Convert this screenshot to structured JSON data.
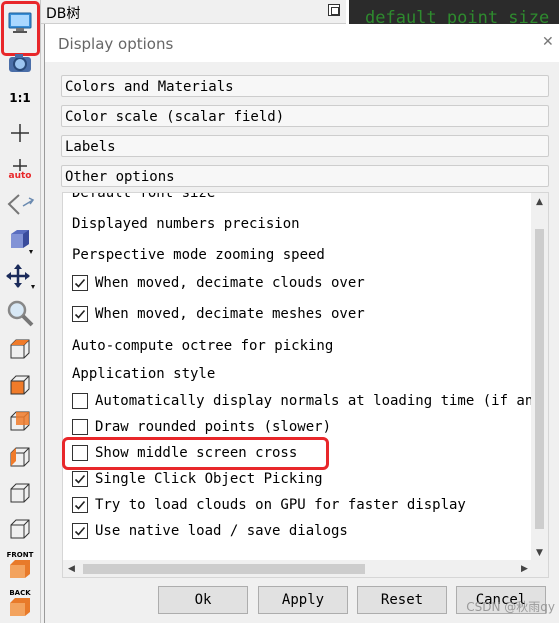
{
  "dbtree": {
    "title": "DB树"
  },
  "console": {
    "text": "default point size"
  },
  "toolbar": {
    "label_1to1": "1:1",
    "label_auto": "auto",
    "label_front": "FRONT",
    "label_back": "BACK",
    "accent": "#e8272a"
  },
  "dialog": {
    "title": "Display options",
    "sections": {
      "colors": "Colors and Materials",
      "color_scale": "Color scale (scalar field)",
      "labels": "Labels",
      "other": "Other options"
    },
    "rows": {
      "font_size": "Default font size",
      "precision": "Displayed numbers precision",
      "zoom": "Perspective mode zooming speed",
      "decimate_clouds": "When moved, decimate clouds over",
      "decimate_meshes": "When moved, decimate meshes over",
      "octree": "Auto-compute octree for picking",
      "app_style": "Application style",
      "normals": "Automatically display normals at loading time (if any)",
      "rounded": "Draw rounded points (slower)",
      "cross": "Show middle screen cross",
      "single_click": "Single Click Object Picking",
      "gpu": "Try to load clouds on GPU for faster display",
      "native_dialogs": "Use native load / save dialogs"
    },
    "checked": {
      "decimate_clouds": true,
      "decimate_meshes": true,
      "normals": false,
      "rounded": false,
      "cross": false,
      "single_click": true,
      "gpu": true,
      "native_dialogs": true
    },
    "buttons": {
      "ok": "Ok",
      "apply": "Apply",
      "reset": "Reset",
      "cancel": "Cancel"
    }
  },
  "watermark": "CSDN @秋雨qy"
}
